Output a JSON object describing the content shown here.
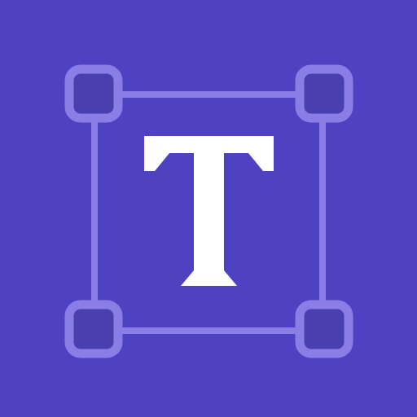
{
  "icon": {
    "name": "text-transform-icon",
    "colors": {
      "background": "#4F42C2",
      "frame": "#8A7EE6",
      "handle_fill": "#4A3FAF",
      "glyph": "#FFFFFF"
    },
    "glyph_icon": "serif-letter-t-icon"
  }
}
